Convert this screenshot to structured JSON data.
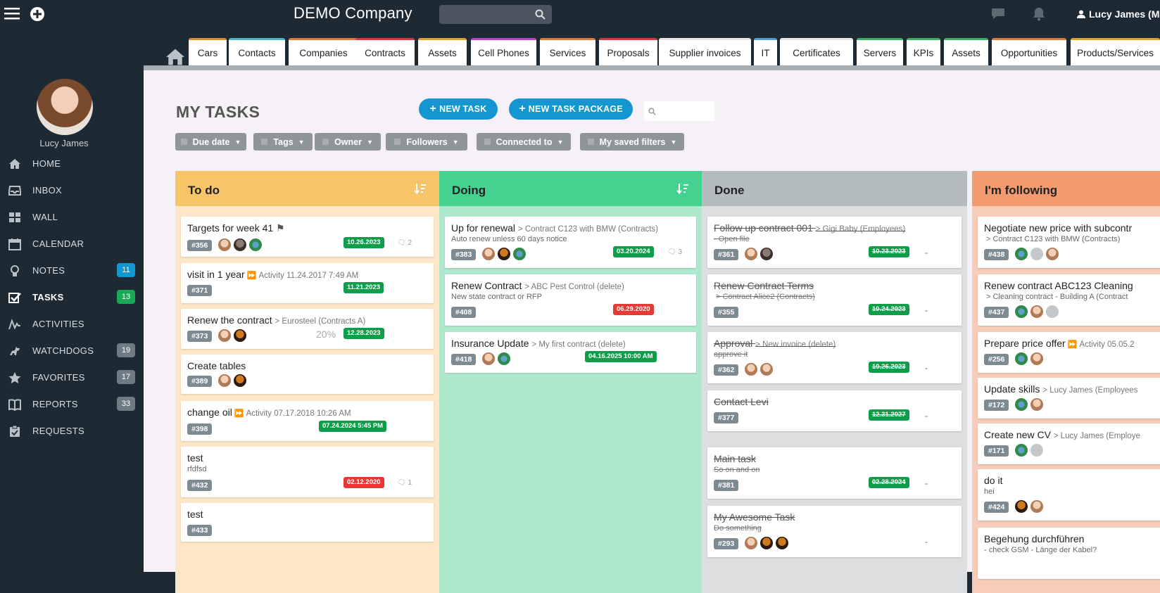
{
  "app": {
    "company": "DEMO Company",
    "user": "Lucy James (Ma"
  },
  "tabs": [
    {
      "label": "Cars",
      "color": "#e08a32"
    },
    {
      "label": "Contacts",
      "color": "#48b8c8"
    },
    {
      "label": "Companies",
      "color": "#e07a30"
    },
    {
      "label": "Contracts",
      "color": "#d03a3a"
    },
    {
      "label": "Assets",
      "color": "#e0a030"
    },
    {
      "label": "Cell Phones",
      "color": "#c040c8"
    },
    {
      "label": "Services",
      "color": "#e07a30"
    },
    {
      "label": "Proposals",
      "color": "#d03a3a"
    },
    {
      "label": "Supplier invoices",
      "color": "#e8e8e8"
    },
    {
      "label": "IT",
      "color": "#48a0d8"
    },
    {
      "label": "Certificates",
      "color": "#e8e8e8"
    },
    {
      "label": "Servers",
      "color": "#38b060"
    },
    {
      "label": "KPIs",
      "color": "#38b060"
    },
    {
      "label": "Assets",
      "color": "#38b060"
    },
    {
      "label": "Opportunities",
      "color": "#e07a30"
    },
    {
      "label": "Products/Services",
      "color": "#e0a030"
    }
  ],
  "sidebar": {
    "user_name": "Lucy James",
    "items": [
      {
        "label": "HOME",
        "icon": "home-icon",
        "count": ""
      },
      {
        "label": "INBOX",
        "icon": "inbox-icon",
        "count": ""
      },
      {
        "label": "WALL",
        "icon": "wall-icon",
        "count": ""
      },
      {
        "label": "CALENDAR",
        "icon": "calendar-icon",
        "count": ""
      },
      {
        "label": "NOTES",
        "icon": "bulb-icon",
        "count": "11"
      },
      {
        "label": "TASKS",
        "icon": "tasks-icon",
        "count": "13"
      },
      {
        "label": "ACTIVITIES",
        "icon": "activity-icon",
        "count": ""
      },
      {
        "label": "WATCHDOGS",
        "icon": "dog-icon",
        "count": "19"
      },
      {
        "label": "FAVORITES",
        "icon": "star-icon",
        "count": "17"
      },
      {
        "label": "REPORTS",
        "icon": "book-icon",
        "count": "33"
      },
      {
        "label": "REQUESTS",
        "icon": "clipboard-icon",
        "count": ""
      }
    ]
  },
  "main": {
    "title": "MY TASKS",
    "new_task": "NEW TASK",
    "new_package": "NEW TASK PACKAGE",
    "filters": [
      "Due date",
      "Tags",
      "Owner",
      "Followers",
      "Connected to",
      "My saved filters"
    ]
  },
  "columns": [
    {
      "title": "To do",
      "cards": [
        {
          "title": "Targets for week 41",
          "sub": "",
          "desc": "",
          "id": "#356",
          "date": "10.26.2023",
          "comments": "2",
          "pct": ""
        },
        {
          "title": "visit in 1 year",
          "sub": "Activity 11.24.2017 7:49 AM",
          "desc": "",
          "id": "#371",
          "date": "11.21.2023",
          "comments": "",
          "pct": ""
        },
        {
          "title": "Renew the contract",
          "sub": "> Eurosteel (Contracts A)",
          "desc": "",
          "id": "#373",
          "date": "12.28.2023",
          "comments": "",
          "pct": "20%"
        },
        {
          "title": "Create tables",
          "sub": "",
          "desc": "",
          "id": "#389",
          "date": "",
          "comments": "",
          "pct": ""
        },
        {
          "title": "change oil",
          "sub": "Activity 07.17.2018 10:26 AM",
          "desc": "",
          "id": "#398",
          "date": "07.24.2024 5:45 PM",
          "comments": "",
          "pct": ""
        },
        {
          "title": "test",
          "sub": "",
          "desc": "rfdfsd",
          "id": "#432",
          "date": "02.12.2020",
          "comments": "1",
          "pct": ""
        },
        {
          "title": "test",
          "sub": "",
          "desc": "",
          "id": "#433",
          "date": "",
          "comments": "",
          "pct": ""
        }
      ]
    },
    {
      "title": "Doing",
      "cards": [
        {
          "title": "Up for renewal",
          "sub": "> Contract C123 with BMW (Contracts)",
          "desc": "Auto renew unless 60 days notice",
          "id": "#383",
          "date": "03.20.2024",
          "comments": "3"
        },
        {
          "title": "Renew Contract",
          "sub": "> ABC Pest Control (delete)",
          "desc": "New state contract or RFP",
          "id": "#408",
          "date": "06.29.2020",
          "comments": ""
        },
        {
          "title": "Insurance Update",
          "sub": "> My first contract (delete)",
          "desc": "",
          "id": "#418",
          "date": "04.16.2025 10:00 AM",
          "comments": ""
        }
      ]
    },
    {
      "title": "Done",
      "cards": [
        {
          "title": "Follow up contract 001",
          "sub": "> Gigi Baby (Employees)",
          "desc": "- Open file",
          "id": "#361",
          "date": "10.23.2023"
        },
        {
          "title": "Renew Contract Terms",
          "sub": "",
          "desc": "> Contract Alice2 (Contracts)",
          "id": "#355",
          "date": "10.24.2023"
        },
        {
          "title": "Approval",
          "sub": "> New invoice (delete)",
          "desc": "approve it",
          "id": "#362",
          "date": "10.26.2023"
        },
        {
          "title": "Contact Levi",
          "sub": "",
          "desc": "",
          "id": "#377",
          "date": "12.31.2027"
        },
        {
          "title": "Main task",
          "sub": "",
          "desc": "So on and on",
          "id": "#381",
          "date": "02.28.2024"
        },
        {
          "title": "My Awesome Task",
          "sub": "",
          "desc": "Do something",
          "id": "#293",
          "date": ""
        }
      ]
    },
    {
      "title": "I'm following",
      "cards": [
        {
          "title": "Negotiate new price with subcontr",
          "sub": "",
          "desc": "> Contract C123 with BMW (Contracts)",
          "id": "#438"
        },
        {
          "title": "Renew contract ABC123 Cleaning",
          "sub": "",
          "desc": "> Cleaning contract - Building A (Contract",
          "id": "#437"
        },
        {
          "title": "Prepare price offer",
          "sub": "Activity 05.05.2",
          "desc": "",
          "id": "#256"
        },
        {
          "title": "Update skills",
          "sub": "> Lucy James (Employees",
          "desc": "",
          "id": "#172"
        },
        {
          "title": "Create new CV",
          "sub": "> Lucy James (Employe",
          "desc": "",
          "id": "#171"
        },
        {
          "title": "do it",
          "sub": "",
          "desc": "hei",
          "id": "#424"
        },
        {
          "title": "Begehung durchführen",
          "sub": "",
          "desc": "- check GSM - Länge der Kabel?",
          "id": ""
        }
      ]
    }
  ],
  "colors": {
    "dark": "#1e2a33",
    "accent": "#1496d0",
    "todo": "#f7c46a",
    "doing": "#45d290",
    "done": "#b4bcc0",
    "following": "#f39a6f",
    "date_green": "#0f9d4a",
    "date_red": "#e53935",
    "badge_blue": "#1496d0",
    "badge_green": "#18a957",
    "badge_grey": "#6f7b82"
  }
}
